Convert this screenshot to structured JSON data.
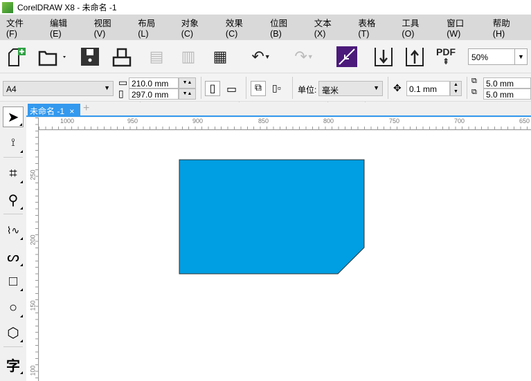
{
  "window": {
    "title": "CorelDRAW X8 - 未命名 -1"
  },
  "menu": [
    "文件(F)",
    "编辑(E)",
    "视图(V)",
    "布局(L)",
    "对象(C)",
    "效果(C)",
    "位图(B)",
    "文本(X)",
    "表格(T)",
    "工具(O)",
    "窗口(W)",
    "帮助(H)"
  ],
  "toolbar": {
    "pdf_label": "PDF",
    "zoom": "50%"
  },
  "property_bar": {
    "page_size": "A4",
    "width": "210.0 mm",
    "height": "297.0 mm",
    "unit_label": "单位:",
    "unit": "毫米",
    "nudge": "0.1 mm",
    "dup_x": "5.0 mm",
    "dup_y": "5.0 mm"
  },
  "tab": {
    "label": "未命名 -1",
    "close": "×",
    "add": "+"
  },
  "rulers": {
    "horizontal": [
      "1000",
      "950",
      "900",
      "850",
      "800",
      "750",
      "700",
      "650"
    ],
    "vertical": [
      "250",
      "200",
      "150",
      "100"
    ]
  },
  "toolbox": {
    "text_tool": "字"
  },
  "shape": {
    "fill": "#009ee2",
    "stroke": "#333333"
  }
}
